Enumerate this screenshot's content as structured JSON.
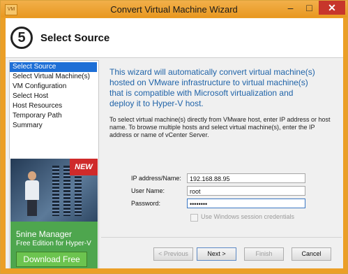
{
  "window": {
    "title": "Convert Virtual Machine Wizard",
    "app_icon_text": "VM",
    "controls": {
      "minimize": "–",
      "maximize": "□",
      "close": "✕"
    }
  },
  "header": {
    "step_number": "5",
    "step_title": "Select Source"
  },
  "sidebar": {
    "items": [
      {
        "label": "Select Source",
        "active": true
      },
      {
        "label": "Select Virtual Machine(s)",
        "active": false
      },
      {
        "label": "VM Configuration",
        "active": false
      },
      {
        "label": "Select Host",
        "active": false
      },
      {
        "label": "Host Resources",
        "active": false
      },
      {
        "label": "Temporary Path",
        "active": false
      },
      {
        "label": "Summary",
        "active": false
      }
    ]
  },
  "ad": {
    "badge": "NEW",
    "product": "5nine Manager",
    "edition": "Free Edition for Hyper-V",
    "button": "Download Free"
  },
  "main": {
    "intro": "This wizard will automatically convert virtual machine(s) hosted on VMware infrastructure to virtual machine(s) that is compatible with Microsoft virtualization and deploy it to Hyper-V host.",
    "description": "To select virtual machine(s) directly from VMware host, enter IP address or host name. To browse multiple hosts and select virtual machine(s), enter the IP address or name of vCenter Server.",
    "fields": {
      "ip_label": "IP address/Name:",
      "ip_value": "192.168.88.95",
      "user_label": "User Name:",
      "user_value": "root",
      "password_label": "Password:",
      "password_value": "••••••••"
    },
    "checkbox_label": "Use Windows session credentials"
  },
  "footer": {
    "previous": "< Previous",
    "next": "Next >",
    "finish": "Finish",
    "cancel": "Cancel"
  }
}
